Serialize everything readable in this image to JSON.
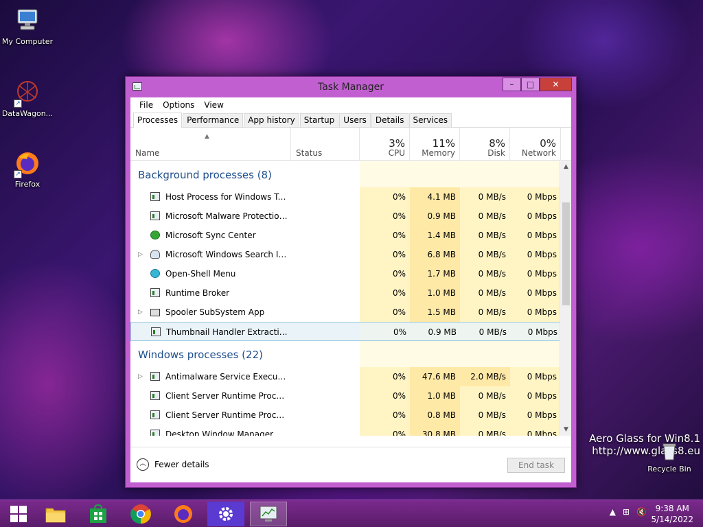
{
  "desktop": {
    "icons": [
      {
        "label": "My Computer"
      },
      {
        "label": "DataWagon..."
      },
      {
        "label": "Firefox"
      }
    ],
    "recycle_bin": "Recycle Bin",
    "watermark_line1": "Aero Glass for Win8.1",
    "watermark_line2": "http://www.glass8.eu"
  },
  "window": {
    "title": "Task Manager",
    "controls": {
      "minimize": "–",
      "maximize": "□",
      "close": "✕"
    }
  },
  "menu": [
    "File",
    "Options",
    "View"
  ],
  "tabs": [
    "Processes",
    "Performance",
    "App history",
    "Startup",
    "Users",
    "Details",
    "Services"
  ],
  "active_tab": "Processes",
  "columns": {
    "name": "Name",
    "status": "Status",
    "cpu": {
      "pct": "3%",
      "label": "CPU"
    },
    "memory": {
      "pct": "11%",
      "label": "Memory"
    },
    "disk": {
      "pct": "8%",
      "label": "Disk"
    },
    "network": {
      "pct": "0%",
      "label": "Network"
    }
  },
  "groups": [
    {
      "title": "Background processes (8)",
      "rows": [
        {
          "name": "Host Process for Windows Tasks",
          "icon": "app-window-icon",
          "expandable": false,
          "cpu": "0%",
          "memory": "4.1 MB",
          "disk": "0 MB/s",
          "network": "0 Mbps"
        },
        {
          "name": "Microsoft Malware Protection C...",
          "icon": "app-window-icon",
          "expandable": false,
          "cpu": "0%",
          "memory": "0.9 MB",
          "disk": "0 MB/s",
          "network": "0 Mbps"
        },
        {
          "name": "Microsoft Sync Center",
          "icon": "sync-icon",
          "expandable": false,
          "cpu": "0%",
          "memory": "1.4 MB",
          "disk": "0 MB/s",
          "network": "0 Mbps"
        },
        {
          "name": "Microsoft Windows Search Inde...",
          "icon": "search-user-icon",
          "expandable": true,
          "cpu": "0%",
          "memory": "6.8 MB",
          "disk": "0 MB/s",
          "network": "0 Mbps"
        },
        {
          "name": "Open-Shell Menu",
          "icon": "shell-icon",
          "expandable": false,
          "cpu": "0%",
          "memory": "1.7 MB",
          "disk": "0 MB/s",
          "network": "0 Mbps"
        },
        {
          "name": "Runtime Broker",
          "icon": "app-window-icon",
          "expandable": false,
          "cpu": "0%",
          "memory": "1.0 MB",
          "disk": "0 MB/s",
          "network": "0 Mbps"
        },
        {
          "name": "Spooler SubSystem App",
          "icon": "printer-icon",
          "expandable": true,
          "cpu": "0%",
          "memory": "1.5 MB",
          "disk": "0 MB/s",
          "network": "0 Mbps"
        },
        {
          "name": "Thumbnail Handler Extraction ...",
          "icon": "app-window-icon",
          "expandable": false,
          "cpu": "0%",
          "memory": "0.9 MB",
          "disk": "0 MB/s",
          "network": "0 Mbps",
          "selected": true
        }
      ]
    },
    {
      "title": "Windows processes (22)",
      "rows": [
        {
          "name": "Antimalware Service Executable",
          "icon": "app-window-icon",
          "expandable": true,
          "cpu": "0%",
          "memory": "47.6 MB",
          "disk": "2.0 MB/s",
          "network": "0 Mbps"
        },
        {
          "name": "Client Server Runtime Process",
          "icon": "app-window-icon",
          "expandable": false,
          "cpu": "0%",
          "memory": "1.0 MB",
          "disk": "0 MB/s",
          "network": "0 Mbps"
        },
        {
          "name": "Client Server Runtime Process",
          "icon": "app-window-icon",
          "expandable": false,
          "cpu": "0%",
          "memory": "0.8 MB",
          "disk": "0 MB/s",
          "network": "0 Mbps"
        },
        {
          "name": "Desktop Window Manager",
          "icon": "app-window-icon",
          "expandable": false,
          "cpu": "0%",
          "memory": "30.8 MB",
          "disk": "0 MB/s",
          "network": "0 Mbps"
        }
      ]
    }
  ],
  "footer": {
    "fewer_details": "Fewer details",
    "end_task": "End task"
  },
  "taskbar": {
    "time": "9:38 AM",
    "date": "5/14/2022"
  },
  "colors": {
    "accent": "#c15fd0",
    "group_title": "#1e4e8c",
    "cell_tint": "#fff4c4",
    "cell_tint_strong": "#ffe9a6",
    "taskbar": "#6a2479"
  }
}
